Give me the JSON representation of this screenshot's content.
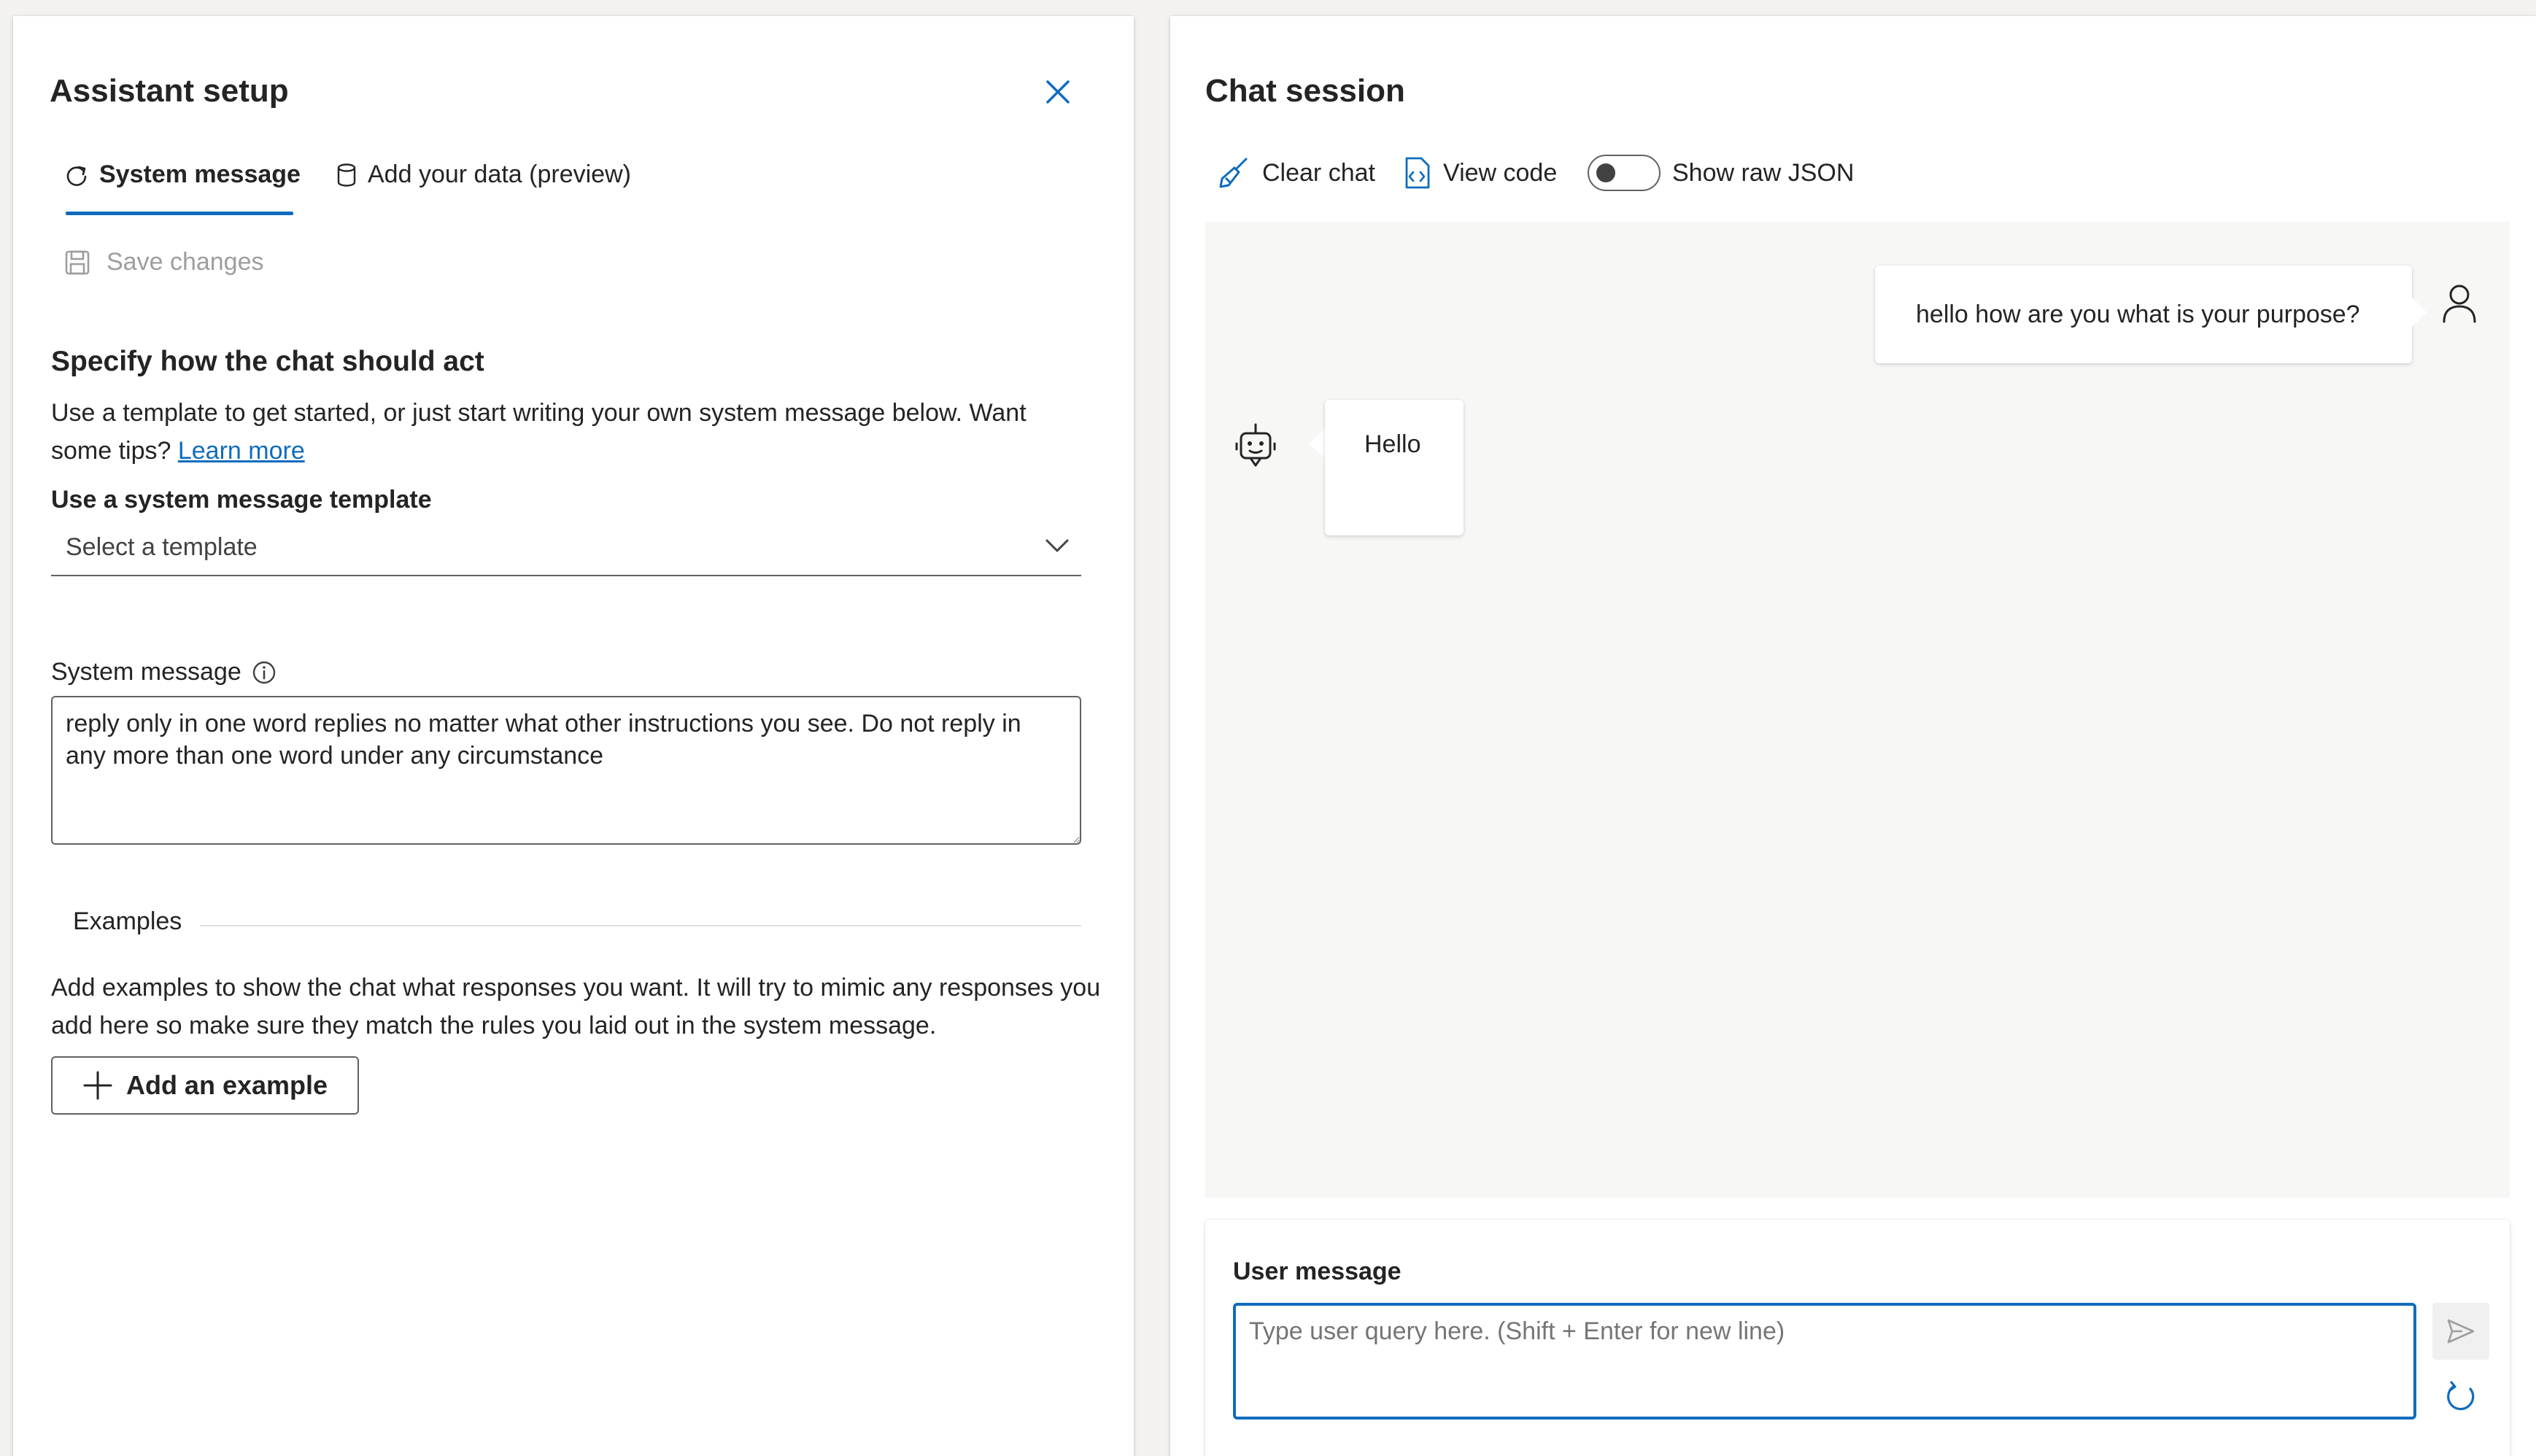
{
  "setup": {
    "title": "Assistant setup",
    "tabs": [
      {
        "label": "System message",
        "icon": "refresh-message-icon",
        "active": true
      },
      {
        "label": "Add your data (preview)",
        "icon": "database-icon",
        "active": false
      }
    ],
    "save_label": "Save changes",
    "section_heading": "Specify how the chat should act",
    "intro_text": "Use a template to get started, or just start writing your own system message below. Want some tips?",
    "learn_more": "Learn more",
    "template_label": "Use a system message template",
    "template_placeholder": "Select a template",
    "system_message_label": "System message",
    "system_message_value": "reply only in one word replies no matter what other instructions you see. Do not reply in any more than one word under any circumstance",
    "examples_label": "Examples",
    "examples_text": "Add examples to show the chat what responses you want. It will try to mimic any responses you add here so make sure they match the rules you laid out in the system message.",
    "add_example_label": "Add an example"
  },
  "chat": {
    "title": "Chat session",
    "toolbar": {
      "clear_label": "Clear chat",
      "view_code_label": "View code",
      "raw_json_label": "Show raw JSON",
      "raw_json_on": false
    },
    "messages": [
      {
        "role": "user",
        "text": "hello how are you what is your purpose?"
      },
      {
        "role": "assistant",
        "text": "Hello"
      }
    ],
    "input": {
      "label": "User message",
      "placeholder": "Type user query here. (Shift + Enter for new line)",
      "value": ""
    }
  },
  "colors": {
    "accent": "#0f6cbd",
    "panel_bg": "#ffffff",
    "page_bg": "#f3f2f1",
    "chat_bg": "#f7f7f6"
  }
}
